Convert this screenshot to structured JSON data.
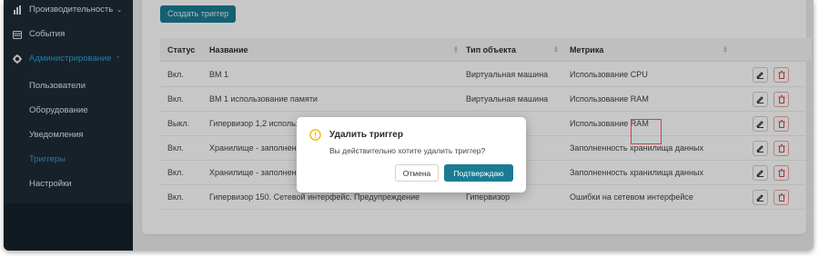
{
  "sidebar": {
    "items": [
      {
        "label": "Производительность",
        "icon": "bar-chart-icon"
      },
      {
        "label": "События",
        "icon": "calendar-icon"
      },
      {
        "label": "Администрирование",
        "icon": "gear-icon"
      },
      {
        "label": "Пользователи"
      },
      {
        "label": "Оборудование"
      },
      {
        "label": "Уведомления"
      },
      {
        "label": "Триггеры"
      },
      {
        "label": "Настройки"
      }
    ]
  },
  "toolbar": {
    "create_label": "Создать триггер"
  },
  "table": {
    "headers": [
      "Статус",
      "Название",
      "Тип объекта",
      "Метрика"
    ],
    "rows": [
      {
        "status": "Вкл.",
        "name": "ВМ 1",
        "type": "Виртуальная машина",
        "metric": "Использование CPU"
      },
      {
        "status": "Вкл.",
        "name": "ВМ 1 использование памяти",
        "type": "Виртуальная машина",
        "metric": "Использование RAM"
      },
      {
        "status": "Выкл.",
        "name": "Гипервизор 1,2 использов",
        "type": "",
        "metric": "Использование RAM"
      },
      {
        "status": "Вкл.",
        "name": "Хранилище - заполненност",
        "type": "",
        "metric": "Заполненность хранилища данных"
      },
      {
        "status": "Вкл.",
        "name": "Хранилище - заполненност",
        "type": "",
        "metric": "Заполненность хранилища данных"
      },
      {
        "status": "Вкл.",
        "name": "Гипервизор 150. Сетевой интерфейс. Предупреждение",
        "type": "Гипервизор",
        "metric": "Ошибки на сетевом интерфейсе"
      }
    ]
  },
  "dialog": {
    "title": "Удалить триггер",
    "message": "Вы действительно хотите удалить триггер?",
    "cancel_label": "Отмена",
    "confirm_label": "Подтверждаю"
  },
  "colors": {
    "sidebar_bg": "#1e2b37",
    "accent": "#2ea0cf",
    "primary_button": "#1a7c93",
    "delete_red": "#d9393e",
    "warning_yellow": "#f0b400",
    "highlight_red": "#e23a3a"
  }
}
